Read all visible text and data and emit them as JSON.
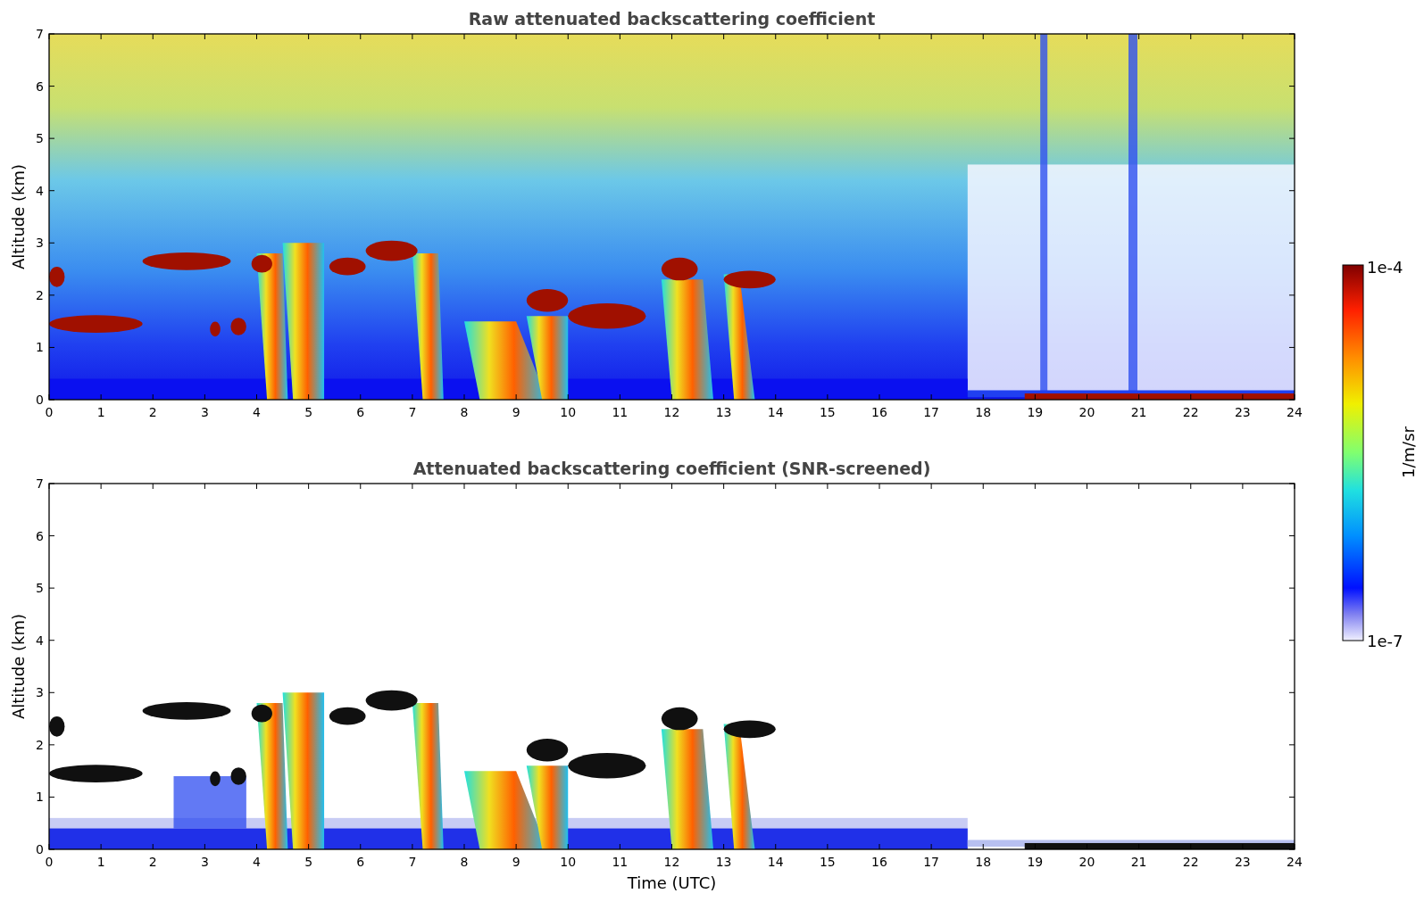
{
  "panels": [
    {
      "title": "Raw attenuated backscattering coefficient",
      "ylabel": "Altitude (km)",
      "yticks": [
        "7",
        "6",
        "5",
        "4",
        "3",
        "2",
        "1",
        "0"
      ],
      "xticks": [
        "0",
        "1",
        "2",
        "3",
        "4",
        "5",
        "6",
        "7",
        "8",
        "9",
        "10",
        "11",
        "12",
        "13",
        "14",
        "15",
        "16",
        "17",
        "18",
        "19",
        "20",
        "21",
        "22",
        "23",
        "24"
      ],
      "kind": "raw"
    },
    {
      "title": "Attenuated backscattering coefficient (SNR-screened)",
      "ylabel": "Altitude (km)",
      "yticks": [
        "7",
        "6",
        "5",
        "4",
        "3",
        "2",
        "1",
        "0"
      ],
      "xticks": [
        "0",
        "1",
        "2",
        "3",
        "4",
        "5",
        "6",
        "7",
        "8",
        "9",
        "10",
        "11",
        "12",
        "13",
        "14",
        "15",
        "16",
        "17",
        "18",
        "19",
        "20",
        "21",
        "22",
        "23",
        "24"
      ],
      "xlabel": "Time (UTC)",
      "kind": "screened"
    }
  ],
  "colorbar": {
    "label": "1/m/sr",
    "top": "1e-4",
    "bottom": "1e-7"
  }
}
